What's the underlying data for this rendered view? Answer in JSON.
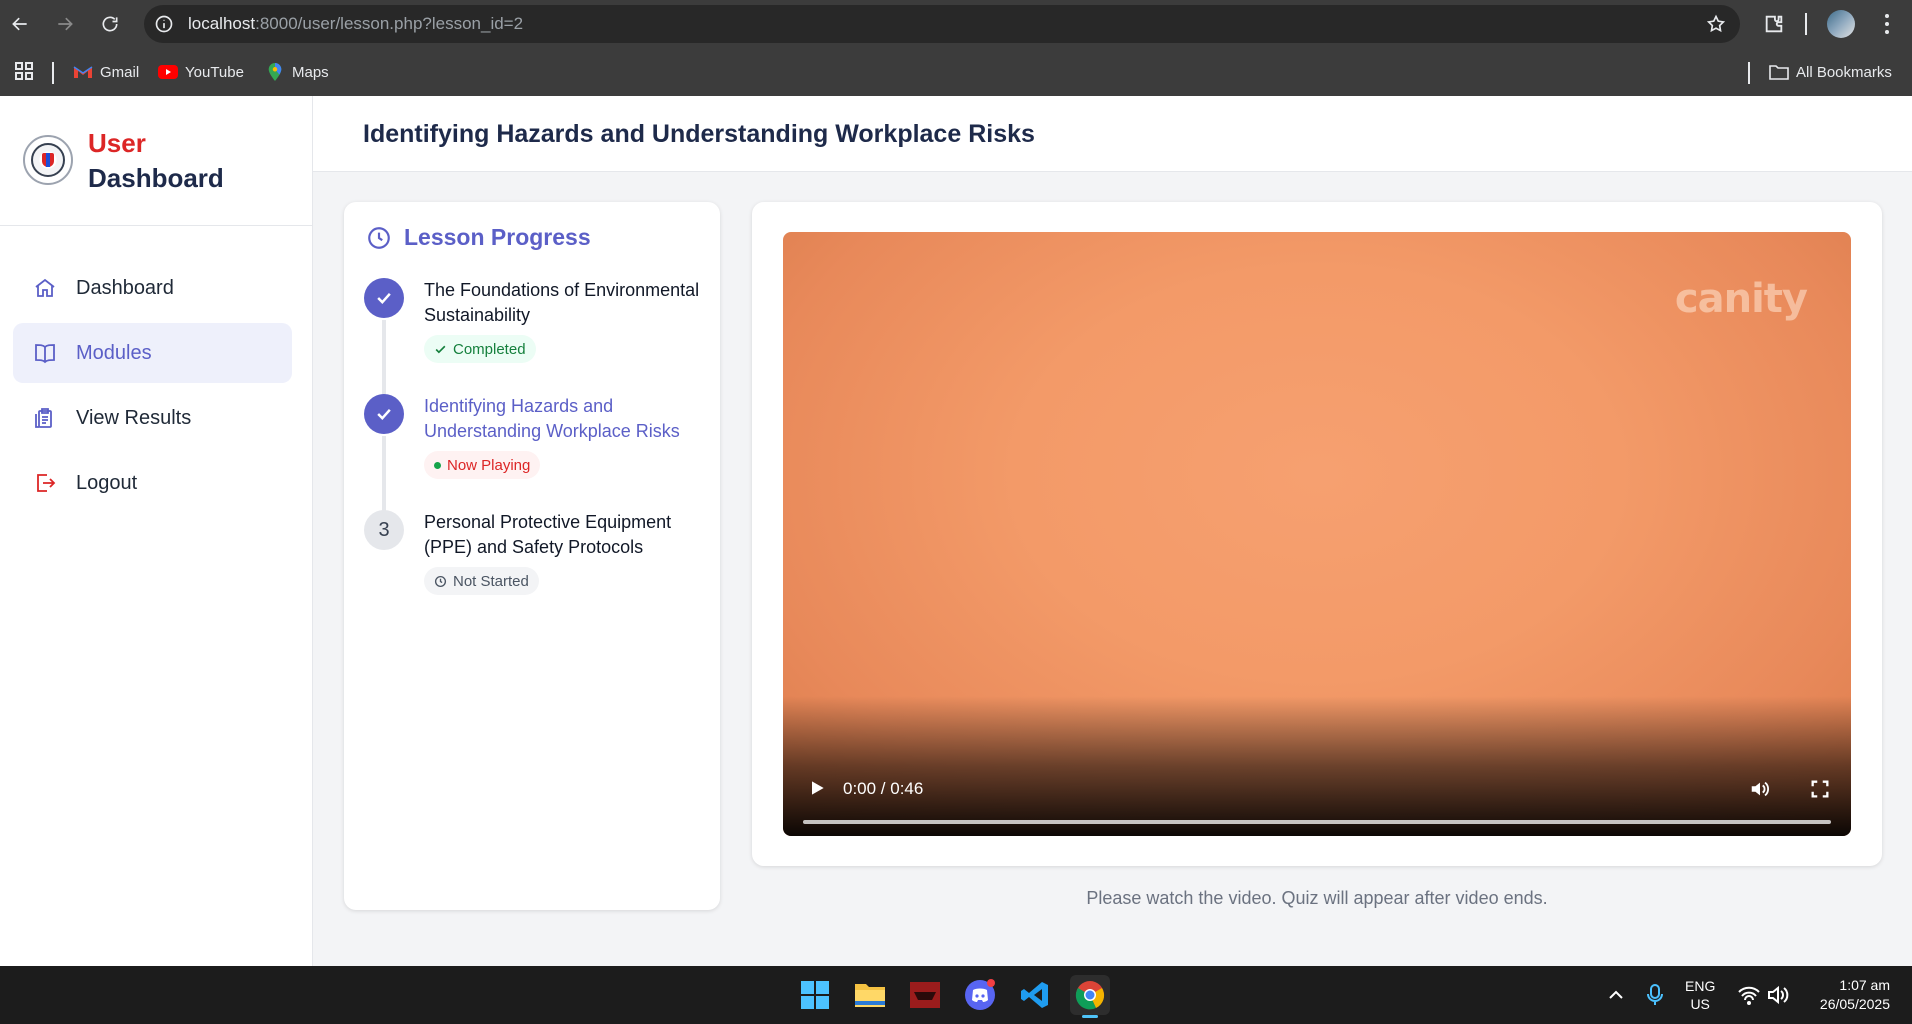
{
  "browser": {
    "url_host": "localhost",
    "url_rest": ":8000/user/lesson.php?lesson_id=2",
    "bookmarks": [
      "Gmail",
      "YouTube",
      "Maps"
    ],
    "all_bookmarks": "All Bookmarks"
  },
  "sidebar": {
    "brand_line1": "User",
    "brand_line2": "Dashboard",
    "items": [
      {
        "label": "Dashboard",
        "icon": "home-icon",
        "active": false
      },
      {
        "label": "Modules",
        "icon": "book-icon",
        "active": true
      },
      {
        "label": "View Results",
        "icon": "clipboard-icon",
        "active": false
      },
      {
        "label": "Logout",
        "icon": "logout-icon",
        "active": false
      }
    ]
  },
  "header": {
    "title": "Identifying Hazards and Understanding Workplace Risks"
  },
  "progress": {
    "heading": "Lesson Progress",
    "steps": [
      {
        "title": "The Foundations of Environmental Sustainability",
        "status": "Completed",
        "state": "done"
      },
      {
        "title": "Identifying Hazards and Understanding Workplace Risks",
        "status": "Now Playing",
        "state": "current"
      },
      {
        "title": "Personal Protective Equipment (PPE) and Safety Protocols",
        "status": "Not Started",
        "state": "pending",
        "number": "3"
      }
    ]
  },
  "video": {
    "watermark": "canity",
    "time": "0:00 / 0:46",
    "progress": 0
  },
  "note": "Please watch the video. Quiz will appear after video ends.",
  "taskbar": {
    "lang_line1": "ENG",
    "lang_line2": "US",
    "time": "1:07 am",
    "date": "26/05/2025"
  },
  "colors": {
    "accent": "#5b5fc7",
    "brand_red": "#dc2626",
    "success": "#15803d"
  }
}
